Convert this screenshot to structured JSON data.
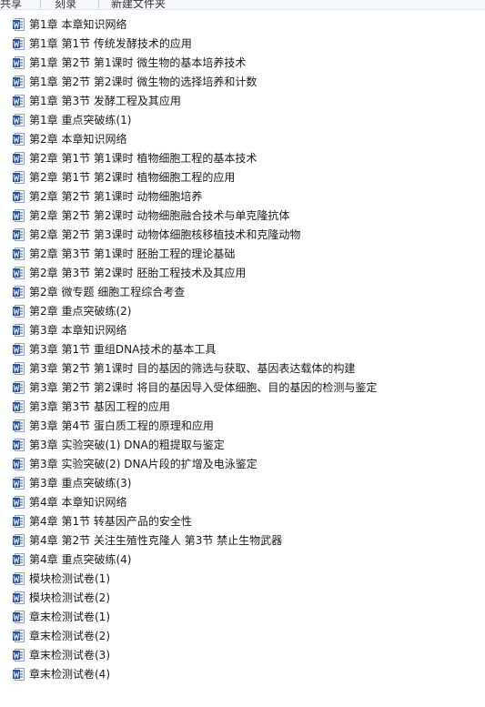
{
  "toolbar": {
    "items": [
      "共享",
      "刻录",
      "新建文件夹"
    ]
  },
  "files": [
    {
      "name": "第1章 本章知识网络",
      "icon": "word-doc-icon"
    },
    {
      "name": "第1章 第1节 传统发酵技术的应用",
      "icon": "word-doc-icon"
    },
    {
      "name": "第1章 第2节 第1课时 微生物的基本培养技术",
      "icon": "word-doc-icon"
    },
    {
      "name": "第1章 第2节 第2课时 微生物的选择培养和计数",
      "icon": "word-doc-icon"
    },
    {
      "name": "第1章 第3节 发酵工程及其应用",
      "icon": "word-doc-icon"
    },
    {
      "name": "第1章 重点突破练(1)",
      "icon": "word-doc-icon"
    },
    {
      "name": "第2章 本章知识网络",
      "icon": "word-doc-icon"
    },
    {
      "name": "第2章 第1节 第1课时 植物细胞工程的基本技术",
      "icon": "word-doc-icon"
    },
    {
      "name": "第2章 第1节 第2课时 植物细胞工程的应用",
      "icon": "word-doc-icon"
    },
    {
      "name": "第2章 第2节 第1课时 动物细胞培养",
      "icon": "word-doc-icon"
    },
    {
      "name": "第2章 第2节 第2课时 动物细胞融合技术与单克隆抗体",
      "icon": "word-doc-icon"
    },
    {
      "name": "第2章 第2节 第3课时 动物体细胞核移植技术和克隆动物",
      "icon": "word-doc-icon"
    },
    {
      "name": "第2章 第3节 第1课时 胚胎工程的理论基础",
      "icon": "word-doc-icon"
    },
    {
      "name": "第2章 第3节 第2课时 胚胎工程技术及其应用",
      "icon": "word-doc-icon"
    },
    {
      "name": "第2章 微专题 细胞工程综合考查",
      "icon": "word-doc-icon"
    },
    {
      "name": "第2章 重点突破练(2)",
      "icon": "word-doc-icon"
    },
    {
      "name": "第3章 本章知识网络",
      "icon": "word-doc-icon"
    },
    {
      "name": "第3章 第1节 重组DNA技术的基本工具",
      "icon": "word-doc-icon"
    },
    {
      "name": "第3章 第2节 第1课时 目的基因的筛选与获取、基因表达载体的构建",
      "icon": "word-doc-icon"
    },
    {
      "name": "第3章 第2节 第2课时 将目的基因导入受体细胞、目的基因的检测与鉴定",
      "icon": "word-doc-icon"
    },
    {
      "name": "第3章 第3节 基因工程的应用",
      "icon": "word-doc-icon"
    },
    {
      "name": "第3章 第4节 蛋白质工程的原理和应用",
      "icon": "word-doc-icon"
    },
    {
      "name": "第3章 实验突破(1) DNA的粗提取与鉴定",
      "icon": "word-doc-icon"
    },
    {
      "name": "第3章 实验突破(2) DNA片段的扩增及电泳鉴定",
      "icon": "word-doc-icon"
    },
    {
      "name": "第3章 重点突破练(3)",
      "icon": "word-doc-icon"
    },
    {
      "name": "第4章 本章知识网络",
      "icon": "word-doc-icon"
    },
    {
      "name": "第4章 第1节 转基因产品的安全性",
      "icon": "word-doc-icon"
    },
    {
      "name": "第4章 第2节 关注生殖性克隆人 第3节 禁止生物武器",
      "icon": "word-doc-icon"
    },
    {
      "name": "第4章 重点突破练(4)",
      "icon": "word-doc-icon"
    },
    {
      "name": "模块检测试卷(1)",
      "icon": "word-doc-icon"
    },
    {
      "name": "模块检测试卷(2)",
      "icon": "word-doc-icon"
    },
    {
      "name": "章末检测试卷(1)",
      "icon": "word-doc-icon"
    },
    {
      "name": "章末检测试卷(2)",
      "icon": "word-doc-icon"
    },
    {
      "name": "章末检测试卷(3)",
      "icon": "word-doc-icon"
    },
    {
      "name": "章末检测试卷(4)",
      "icon": "word-doc-icon"
    }
  ],
  "colors": {
    "icon_blue": "#2b5797",
    "icon_light": "#dfe8f5"
  }
}
